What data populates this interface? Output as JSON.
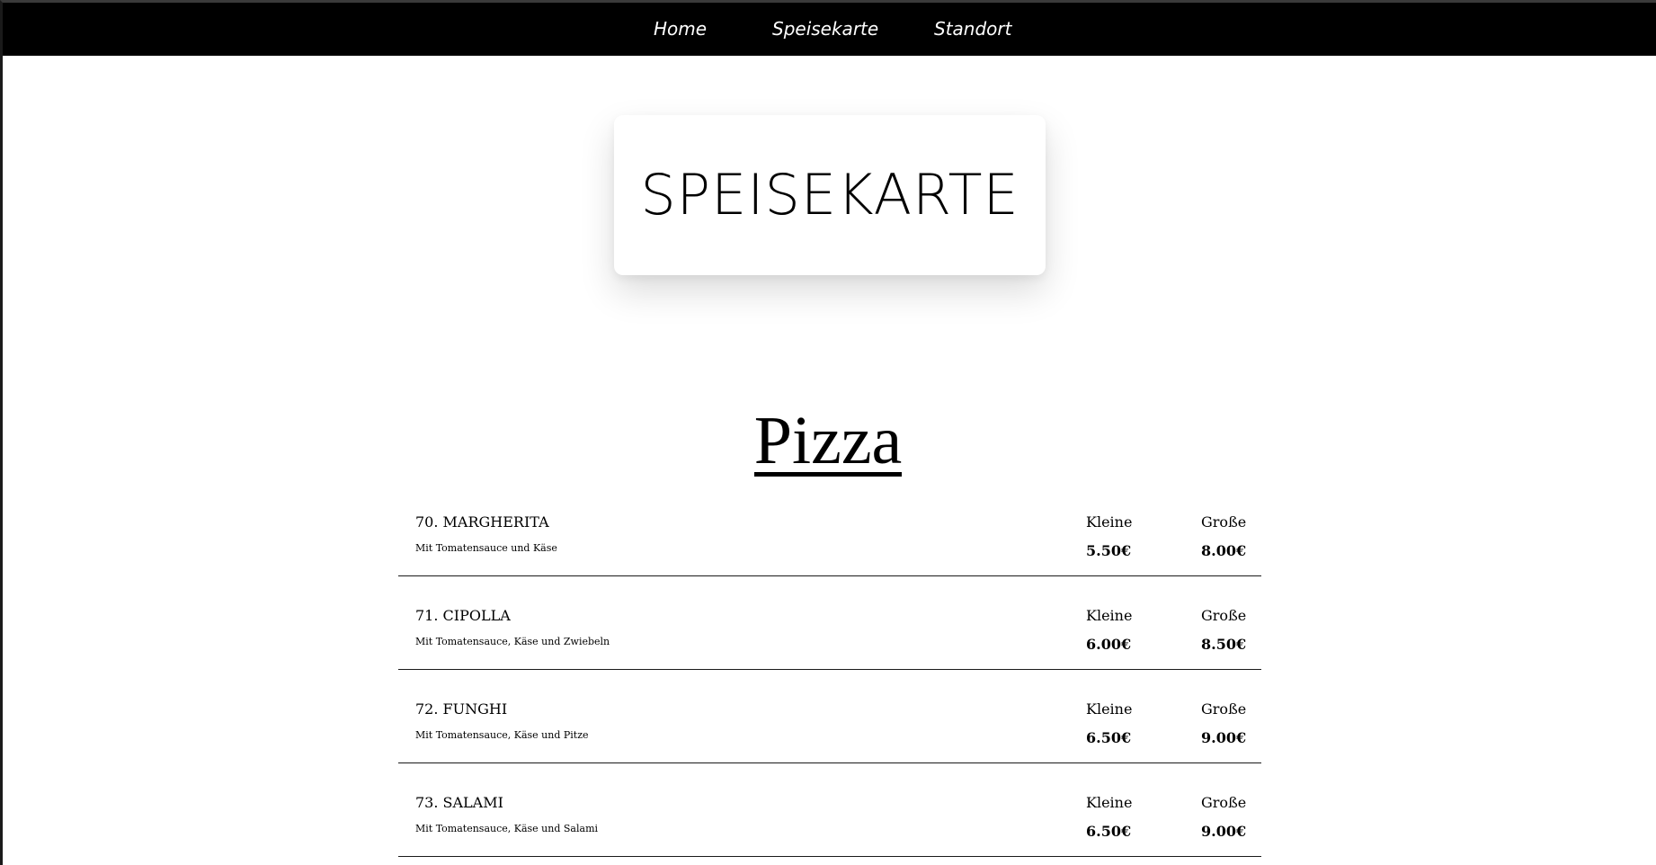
{
  "nav": {
    "home": "Home",
    "menu": "Speisekarte",
    "location": "Standort"
  },
  "title_card": {
    "title": "SPEISEKARTE"
  },
  "section": {
    "heading": "Pizza"
  },
  "sizes": {
    "small_label": "Kleine",
    "large_label": "Große"
  },
  "items": [
    {
      "name": "70. MARGHERITA",
      "description": "Mit Tomatensauce und Käse",
      "price_small": "5.50€",
      "price_large": "8.00€"
    },
    {
      "name": "71. CIPOLLA",
      "description": "Mit Tomatensauce, Käse und Zwiebeln",
      "price_small": "6.00€",
      "price_large": "8.50€"
    },
    {
      "name": "72. FUNGHI",
      "description": "Mit Tomatensauce, Käse und Pitze",
      "price_small": "6.50€",
      "price_large": "9.00€"
    },
    {
      "name": "73. SALAMI",
      "description": "Mit Tomatensauce, Käse und Salami",
      "price_small": "6.50€",
      "price_large": "9.00€"
    }
  ]
}
